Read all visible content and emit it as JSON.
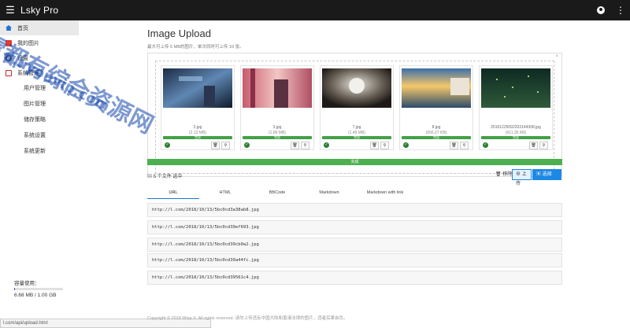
{
  "app": {
    "title": "Lsky Pro"
  },
  "sidebar": {
    "items": [
      {
        "label": "首页"
      },
      {
        "label": "我的图片"
      },
      {
        "label": "设置"
      },
      {
        "label": "系统管理"
      }
    ],
    "sub_items": [
      {
        "label": "用户管理"
      },
      {
        "label": "图片管理"
      },
      {
        "label": "储存策略"
      },
      {
        "label": "系统设置"
      },
      {
        "label": "系统更新"
      }
    ],
    "usage_label": "容量使用：",
    "usage_text": "6.68 MB / 1.00 GB",
    "usage_fraction": 0.0065
  },
  "statusbar": {
    "text": "l.com/api/upload.html"
  },
  "main": {
    "title": "Image Upload",
    "subtitle": "最大可上传 5 MB的图片，单次同时可上传 10 张。",
    "files": [
      {
        "name": "2.jpg",
        "size": "(2.13 MB)",
        "status": "完成"
      },
      {
        "name": "3.jpg",
        "size": "(1.89 MB)",
        "status": "完成"
      },
      {
        "name": "7.jpg",
        "size": "(1.49 MB)",
        "status": "完成"
      },
      {
        "name": "8.jpg",
        "size": "(656.27 KB)",
        "status": "完成"
      },
      {
        "name": "20161225092203144308.jpg",
        "size": "(611.35 KB)",
        "status": "完成"
      }
    ],
    "progress_label": "完成",
    "selected_text": "5 个文件 选中",
    "remove_label": "移除",
    "upload_label": "上传",
    "choose_label": "选择 …",
    "tabs": [
      "URL",
      "HTML",
      "BBCode",
      "Markdown",
      "Markdown with link"
    ],
    "urls": [
      "http://l.com/2018/10/13/5bc0cd3a38ab8.jpg",
      "http://l.com/2018/10/13/5bc0cd39ef693.jpg",
      "http://l.com/2018/10/13/5bc0cd39cb0a2.jpg",
      "http://l.com/2018/10/13/5bc0cd39a44fc.jpg",
      "http://l.com/2018/10/13/5bc0cd39561c4.jpg"
    ],
    "footer": "Copyright © 2018 Wisp X. All rights reserved. 请勿上传违反中国大陆和香港法律的图片，违者后果自负。"
  },
  "watermark": {
    "line1": "雪都有综合资源网",
    "line2": "d.uyouvip.com"
  },
  "colors": {
    "appbar": "#1a1a1a",
    "accent": "#1e88e5",
    "success": "#4caf50"
  }
}
